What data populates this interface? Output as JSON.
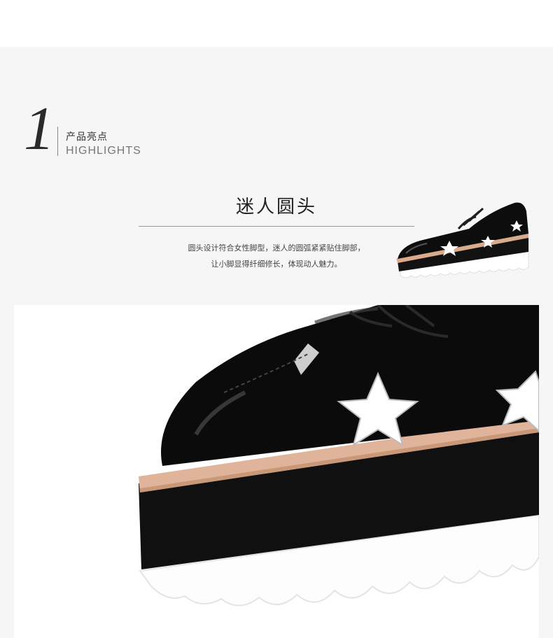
{
  "highlight": {
    "number": "1",
    "title_cn": "产品亮点",
    "title_en": "HIGHLIGHTS"
  },
  "feature": {
    "title": "迷人圆头",
    "desc_line1": "圆头设计符合女性脚型，迷人的圆弧紧紧贴住脚部，",
    "desc_line2": "让小脚显得纤细修长，体现动人魅力。"
  },
  "colors": {
    "background": "#f6f6f6",
    "shoe_leather": "#0b0b0b",
    "welt": "#e0b49a",
    "sole": "#ffffff"
  }
}
